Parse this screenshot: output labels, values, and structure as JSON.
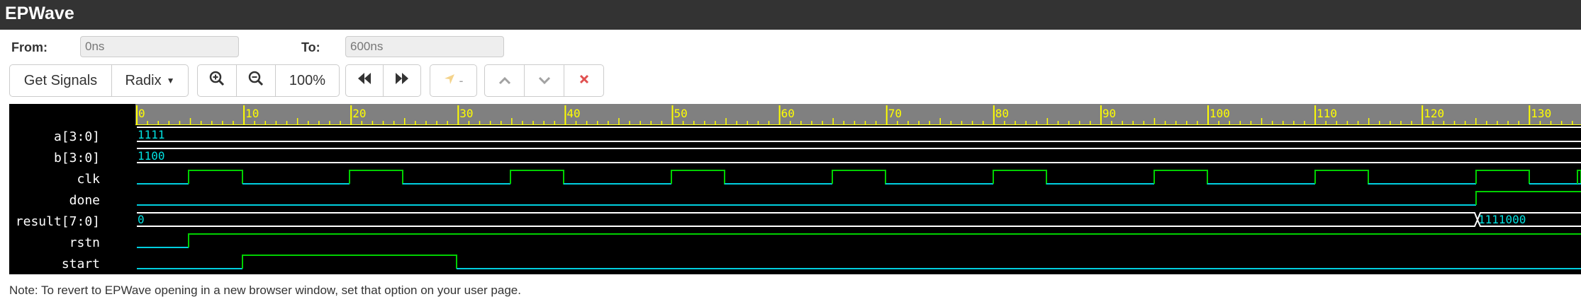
{
  "app": {
    "title": "EPWave"
  },
  "range": {
    "from_label": "From:",
    "from_value": "0ns",
    "to_label": "To:",
    "to_value": "600ns"
  },
  "toolbar": {
    "get_signals": "Get Signals",
    "radix": "Radix",
    "zoom_level": "100%",
    "cursor_value": "-"
  },
  "ruler": {
    "labels": [
      "0",
      "10",
      "20",
      "30",
      "40",
      "50",
      "60",
      "70",
      "80",
      "90",
      "100",
      "110",
      "120",
      "130"
    ]
  },
  "signals": [
    {
      "name": "a[3:0]",
      "type": "bus",
      "segments": [
        {
          "value": "1111"
        }
      ]
    },
    {
      "name": "b[3:0]",
      "type": "bus",
      "segments": [
        {
          "value": "1100"
        }
      ]
    },
    {
      "name": "clk",
      "type": "bit"
    },
    {
      "name": "done",
      "type": "bit"
    },
    {
      "name": "result[7:0]",
      "type": "bus",
      "segments": [
        {
          "value": "0"
        },
        {
          "value": "1111000"
        }
      ]
    },
    {
      "name": "rstn",
      "type": "bit"
    },
    {
      "name": "start",
      "type": "bit"
    }
  ],
  "colors": {
    "titlebar": "#333333",
    "ruler_bg": "#808080",
    "ruler_text": "#ffff00",
    "wave_low": "#00cfe0",
    "wave_high": "#00d000",
    "bus_text": "#00e0e0",
    "wave_bg": "#000000"
  },
  "note": "Note: To revert to EPWave opening in a new browser window, set that option on your user page."
}
